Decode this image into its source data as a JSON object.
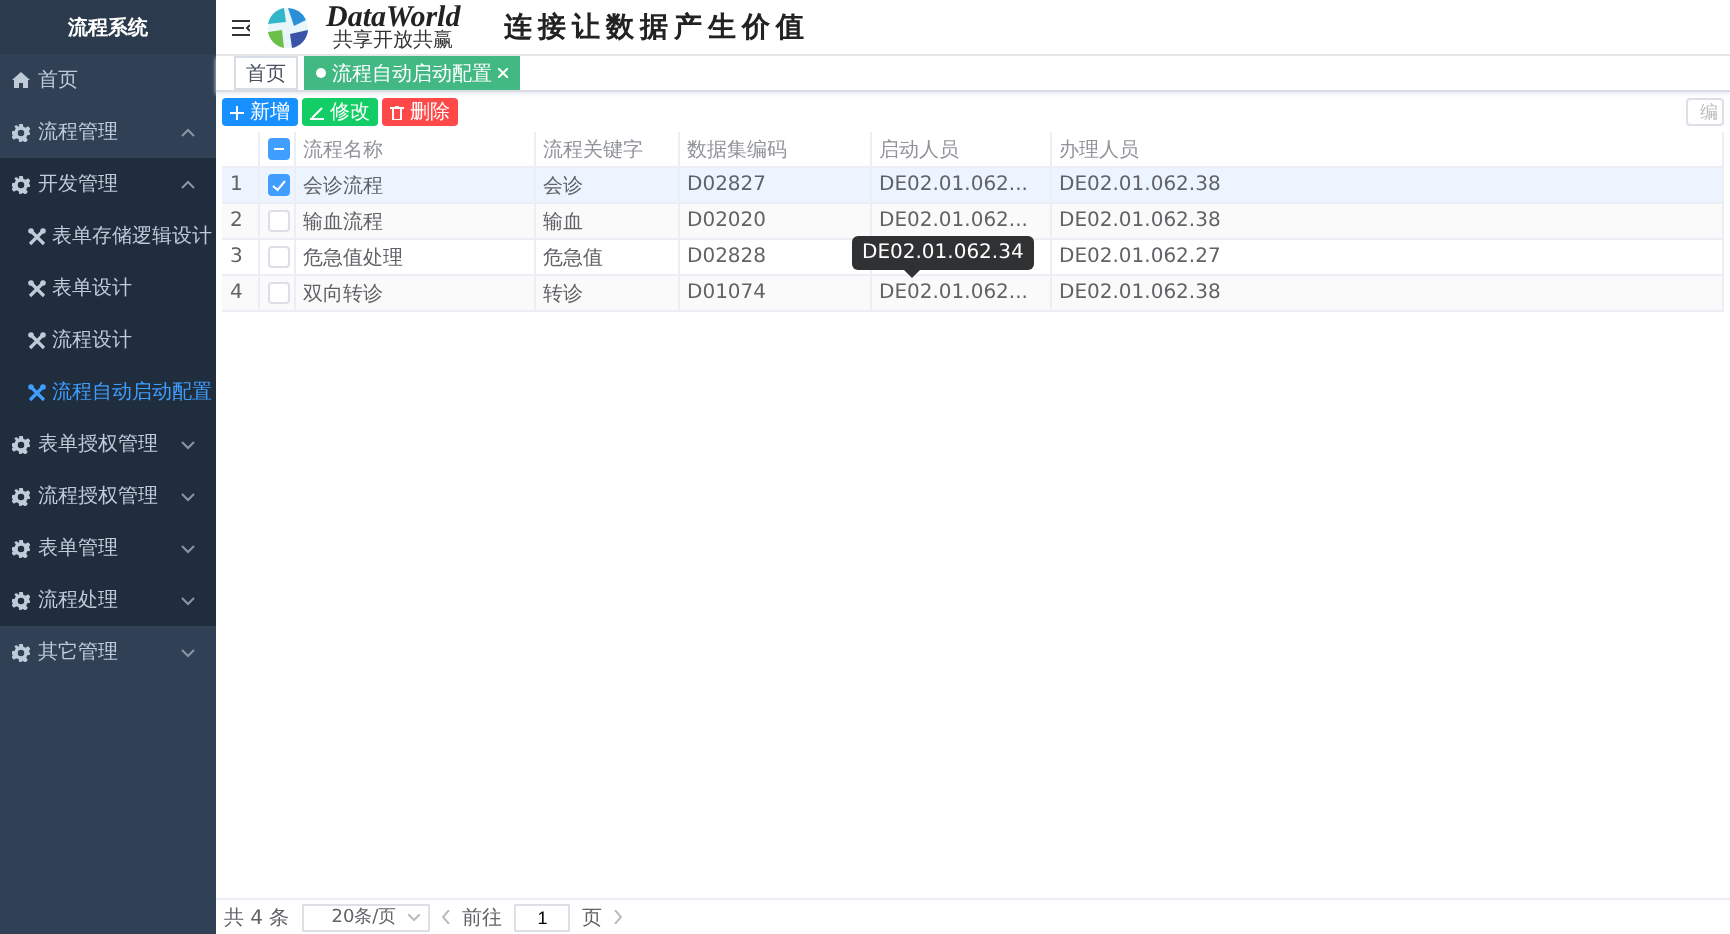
{
  "sidebar": {
    "title": "流程系统",
    "items": [
      {
        "label": "首页",
        "kind": "home",
        "selected": false
      },
      {
        "label": "流程管理",
        "kind": "group",
        "expanded": true,
        "selected": false,
        "children": [
          {
            "label": "开发管理",
            "kind": "group",
            "expanded": true,
            "selected": false,
            "children": [
              {
                "label": "表单存储逻辑设计",
                "kind": "page",
                "selected": false
              },
              {
                "label": "表单设计",
                "kind": "page",
                "selected": false
              },
              {
                "label": "流程设计",
                "kind": "page",
                "selected": false
              },
              {
                "label": "流程自动启动配置",
                "kind": "page",
                "selected": true
              }
            ]
          },
          {
            "label": "表单授权管理",
            "kind": "group",
            "expanded": false,
            "selected": false
          },
          {
            "label": "流程授权管理",
            "kind": "group",
            "expanded": false,
            "selected": false
          },
          {
            "label": "表单管理",
            "kind": "group",
            "expanded": false,
            "selected": false
          },
          {
            "label": "流程处理",
            "kind": "group",
            "expanded": false,
            "selected": false
          }
        ]
      },
      {
        "label": "其它管理",
        "kind": "group",
        "expanded": false,
        "selected": false
      }
    ]
  },
  "header": {
    "logo_name": "DataWorld",
    "logo_motto": "共享开放共赢",
    "slogan": "连接让数据产生价值"
  },
  "tabs": [
    {
      "label": "首页",
      "selected": false,
      "closable": false
    },
    {
      "label": "流程自动启动配置",
      "selected": true,
      "closable": true
    }
  ],
  "toolbar": {
    "buttons": [
      {
        "label": "新增",
        "kind": "add"
      },
      {
        "label": "修改",
        "kind": "edit"
      },
      {
        "label": "删除",
        "kind": "delete"
      }
    ],
    "right_button": "编"
  },
  "table": {
    "header_indeterminate": true,
    "columns": [
      "流程名称",
      "流程关键字",
      "数据集编码",
      "启动人员",
      "办理人员"
    ],
    "rows": [
      {
        "index": "1",
        "selected": true,
        "cells": [
          "会诊流程",
          "会诊",
          "D02827",
          "DE02.01.062...",
          "DE02.01.062.38"
        ]
      },
      {
        "index": "2",
        "selected": false,
        "cells": [
          "输血流程",
          "输血",
          "D02020",
          "DE02.01.062...",
          "DE02.01.062.38"
        ]
      },
      {
        "index": "3",
        "selected": false,
        "cells": [
          "危急值处理",
          "危急值",
          "D02828",
          "",
          "DE02.01.062.27"
        ]
      },
      {
        "index": "4",
        "selected": false,
        "cells": [
          "双向转诊",
          "转诊",
          "D01074",
          "DE02.01.062...",
          "DE02.01.062.38"
        ]
      }
    ],
    "tooltip": "DE02.01.062.34"
  },
  "pagination": {
    "total": "共 4 条",
    "page_size": "20条/页",
    "goto": "前往",
    "page": "1",
    "page_unit": "页"
  }
}
